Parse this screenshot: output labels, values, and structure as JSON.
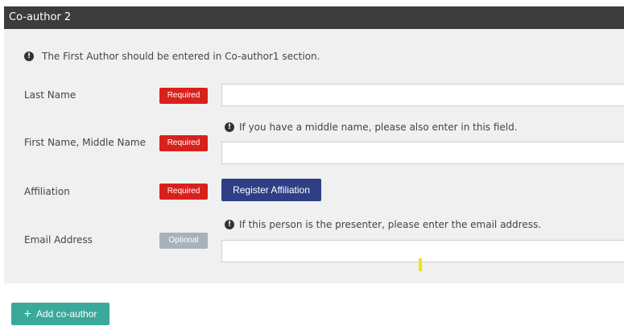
{
  "section": {
    "title": "Co-author 2",
    "first_author_note": "The First Author should be entered in Co-author1 section."
  },
  "fields": {
    "last_name": {
      "label": "Last Name",
      "badge": "Required",
      "value": ""
    },
    "first_name": {
      "label": "First Name, Middle Name",
      "badge": "Required",
      "note": "If you have a middle name, please also enter in this field.",
      "value": ""
    },
    "affiliation": {
      "label": "Affiliation",
      "badge": "Required",
      "button_label": "Register Affiliation"
    },
    "email": {
      "label": "Email Address",
      "badge": "Optional",
      "note": "If this person is the presenter, please enter the email address.",
      "value": ""
    }
  },
  "actions": {
    "add_coauthor_label": "Add co-author"
  },
  "icons": {
    "info": "info-icon",
    "plus": "plus-icon"
  },
  "colors": {
    "header_bg": "#3c3c3c",
    "body_bg": "#f0f0f0",
    "required": "#d9211c",
    "optional": "#a8b2bc",
    "register_button": "#2e3f86",
    "add_button": "#3aa99a"
  }
}
